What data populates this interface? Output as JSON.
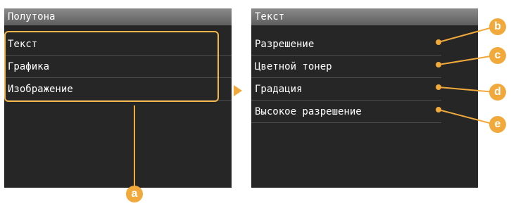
{
  "left_screen": {
    "title": "Полутона",
    "items": [
      "Текст",
      "Графика",
      "Изображение"
    ]
  },
  "right_screen": {
    "title": "Текст",
    "items": [
      "Разрешение",
      "Цветной тонер",
      "Градация",
      "Высокое разрешение"
    ]
  },
  "callouts": {
    "a": "a",
    "b": "b",
    "c": "c",
    "d": "d",
    "e": "e"
  },
  "colors": {
    "accent": "#f2a93b",
    "screen_bg": "#262626",
    "title_bar": "#6e6e6e"
  }
}
